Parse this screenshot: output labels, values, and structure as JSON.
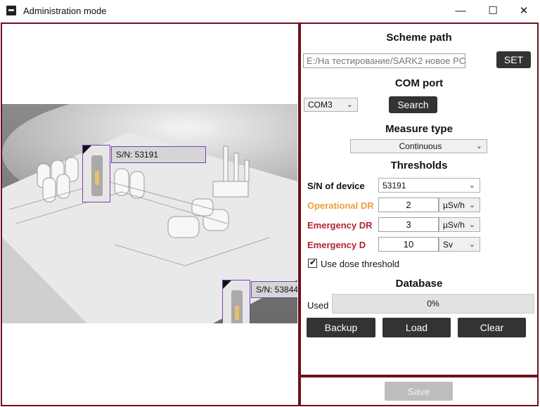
{
  "window": {
    "title": "Administration mode",
    "minimize_glyph": "—",
    "maximize_glyph": "☐",
    "close_glyph": "✕"
  },
  "scene": {
    "tags": [
      {
        "label": "S/N: 53191"
      },
      {
        "label": "S/N: 53844"
      }
    ]
  },
  "scheme": {
    "title": "Scheme path",
    "path_value": "E:/На тестирование/SARK2 новое PC",
    "set_label": "SET"
  },
  "com": {
    "title": "COM port",
    "selected": "COM3",
    "search_label": "Search"
  },
  "measure": {
    "title": "Measure type",
    "selected": "Continuous"
  },
  "thresholds": {
    "title": "Thresholds",
    "sn_label": "S/N of device",
    "sn_value": "53191",
    "operational_label": "Operational DR",
    "operational_value": "2",
    "operational_unit": "µSv/h",
    "emergency_dr_label": "Emergency DR",
    "emergency_dr_value": "3",
    "emergency_dr_unit": "µSv/h",
    "emergency_d_label": "Emergency D",
    "emergency_d_value": "10",
    "emergency_d_unit": "Sv",
    "dose_threshold_label": "Use dose threshold",
    "dose_threshold_checked": true
  },
  "database": {
    "title": "Database",
    "used_label": "Used",
    "used_percent": 0,
    "used_text": "0%",
    "backup_label": "Backup",
    "load_label": "Load",
    "clear_label": "Clear"
  },
  "footer": {
    "save_label": "Save"
  },
  "colors": {
    "frame": "#6e1020",
    "operational": "#e8a13a",
    "emergency": "#b0232f",
    "button_dark": "#333333",
    "tag_border": "#7b3fb0"
  }
}
